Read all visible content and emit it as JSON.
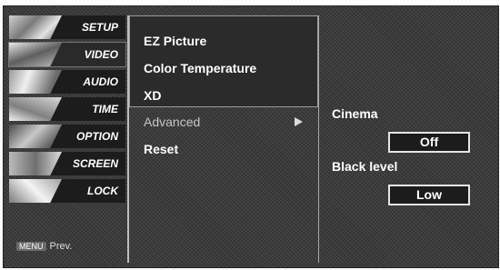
{
  "sidebar": {
    "items": [
      {
        "label": "SETUP"
      },
      {
        "label": "VIDEO"
      },
      {
        "label": "AUDIO"
      },
      {
        "label": "TIME"
      },
      {
        "label": "OPTION"
      },
      {
        "label": "SCREEN"
      },
      {
        "label": "LOCK"
      }
    ],
    "prev": {
      "key": "MENU",
      "label": "Prev."
    }
  },
  "submenu": {
    "items": [
      {
        "label": "EZ Picture"
      },
      {
        "label": "Color Temperature"
      },
      {
        "label": "XD"
      },
      {
        "label": "Advanced"
      },
      {
        "label": "Reset"
      }
    ]
  },
  "panel": {
    "cinema": {
      "label": "Cinema",
      "value": "Off"
    },
    "black_level": {
      "label": "Black level",
      "value": "Low"
    }
  }
}
